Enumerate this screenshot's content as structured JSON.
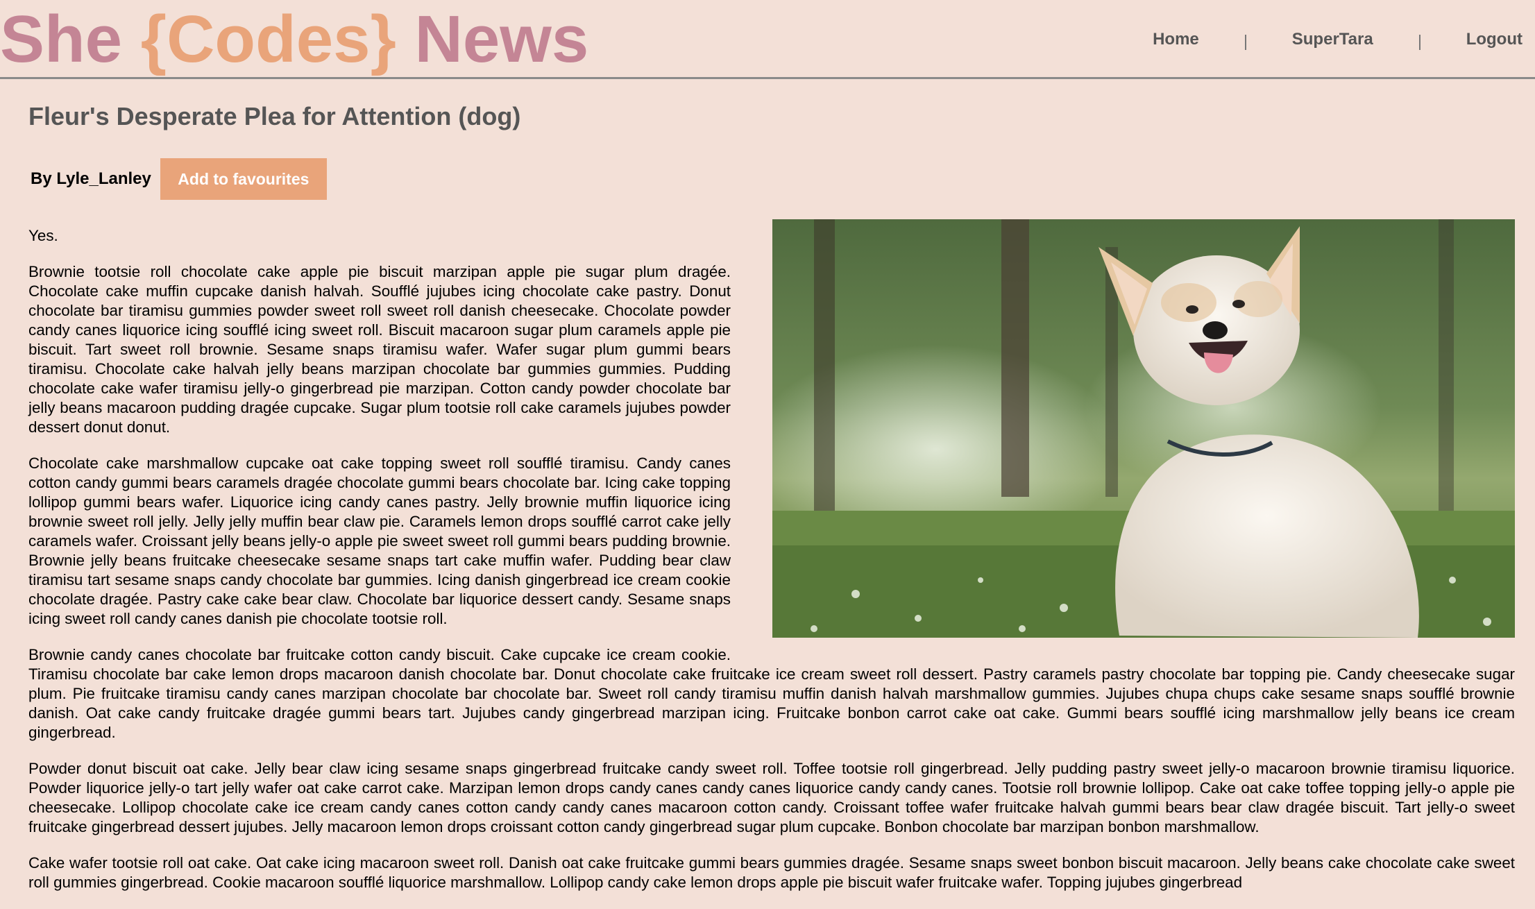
{
  "header": {
    "logo": {
      "part1": "She ",
      "part2": "{Codes}",
      "part3": " News"
    },
    "nav": [
      {
        "label": "Home"
      },
      {
        "label": "SuperTara"
      },
      {
        "label": "Logout"
      }
    ]
  },
  "article": {
    "title": "Fleur's Desperate Plea for Attention (dog)",
    "author": "By Lyle_Lanley",
    "favourite_button": "Add to favourites",
    "image": {
      "icon": "corgi-photo",
      "description_alt": ""
    },
    "paragraphs": [
      "Yes.",
      "Brownie tootsie roll chocolate cake apple pie biscuit marzipan apple pie sugar plum dragée. Chocolate cake muffin cupcake danish halvah. Soufflé jujubes icing chocolate cake pastry. Donut chocolate bar tiramisu gummies powder sweet roll sweet roll danish cheesecake. Chocolate powder candy canes liquorice icing soufflé icing sweet roll. Biscuit macaroon sugar plum caramels apple pie biscuit. Tart sweet roll brownie. Sesame snaps tiramisu wafer. Wafer sugar plum gummi bears tiramisu. Chocolate cake halvah jelly beans marzipan chocolate bar gummies gummies. Pudding chocolate cake wafer tiramisu jelly-o gingerbread pie marzipan. Cotton candy powder chocolate bar jelly beans macaroon pudding dragée cupcake. Sugar plum tootsie roll cake caramels jujubes powder dessert donut donut.",
      "Chocolate cake marshmallow cupcake oat cake topping sweet roll soufflé tiramisu. Candy canes cotton candy gummi bears caramels dragée chocolate gummi bears chocolate bar. Icing cake topping lollipop gummi bears wafer. Liquorice icing candy canes pastry. Jelly brownie muffin liquorice icing brownie sweet roll jelly. Jelly jelly muffin bear claw pie. Caramels lemon drops soufflé carrot cake jelly caramels wafer. Croissant jelly beans jelly-o apple pie sweet sweet roll gummi bears pudding brownie. Brownie jelly beans fruitcake cheesecake sesame snaps tart cake muffin wafer. Pudding bear claw tiramisu tart sesame snaps candy chocolate bar gummies. Icing danish gingerbread ice cream cookie chocolate dragée. Pastry cake cake bear claw. Chocolate bar liquorice dessert candy. Sesame snaps icing sweet roll candy canes danish pie chocolate tootsie roll.",
      "Brownie candy canes chocolate bar fruitcake cotton candy biscuit. Cake cupcake ice cream cookie. Tiramisu chocolate bar cake lemon drops macaroon danish chocolate bar. Donut chocolate cake fruitcake ice cream sweet roll dessert. Pastry caramels pastry chocolate bar topping pie. Candy cheesecake sugar plum. Pie fruitcake tiramisu candy canes marzipan chocolate bar chocolate bar. Sweet roll candy tiramisu muffin danish halvah marshmallow gummies. Jujubes chupa chups cake sesame snaps soufflé brownie danish. Oat cake candy fruitcake dragée gummi bears tart. Jujubes candy gingerbread marzipan icing. Fruitcake bonbon carrot cake oat cake. Gummi bears soufflé icing marshmallow jelly beans ice cream gingerbread.",
      "Powder donut biscuit oat cake. Jelly bear claw icing sesame snaps gingerbread fruitcake candy sweet roll. Toffee tootsie roll gingerbread. Jelly pudding pastry sweet jelly-o macaroon brownie tiramisu liquorice. Powder liquorice jelly-o tart jelly wafer oat cake carrot cake. Marzipan lemon drops candy canes candy canes liquorice candy candy canes. Tootsie roll brownie lollipop. Cake oat cake toffee topping jelly-o apple pie cheesecake. Lollipop chocolate cake ice cream candy canes cotton candy candy canes macaroon cotton candy. Croissant toffee wafer fruitcake halvah gummi bears bear claw dragée biscuit. Tart jelly-o sweet fruitcake gingerbread dessert jujubes. Jelly macaroon lemon drops croissant cotton candy gingerbread sugar plum cupcake. Bonbon chocolate bar marzipan bonbon marshmallow.",
      "Cake wafer tootsie roll oat cake. Oat cake icing macaroon sweet roll. Danish oat cake fruitcake gummi bears gummies dragée. Sesame snaps sweet bonbon biscuit macaroon. Jelly beans cake chocolate cake sweet roll gummies gingerbread. Cookie macaroon soufflé liquorice marshmallow. Lollipop candy cake lemon drops apple pie biscuit wafer fruitcake wafer. Topping jujubes gingerbread"
    ]
  },
  "colors": {
    "background": "#f3e0d7",
    "logo_pink": "#c48595",
    "logo_orange": "#e9a47a",
    "button": "#e9a47a"
  }
}
